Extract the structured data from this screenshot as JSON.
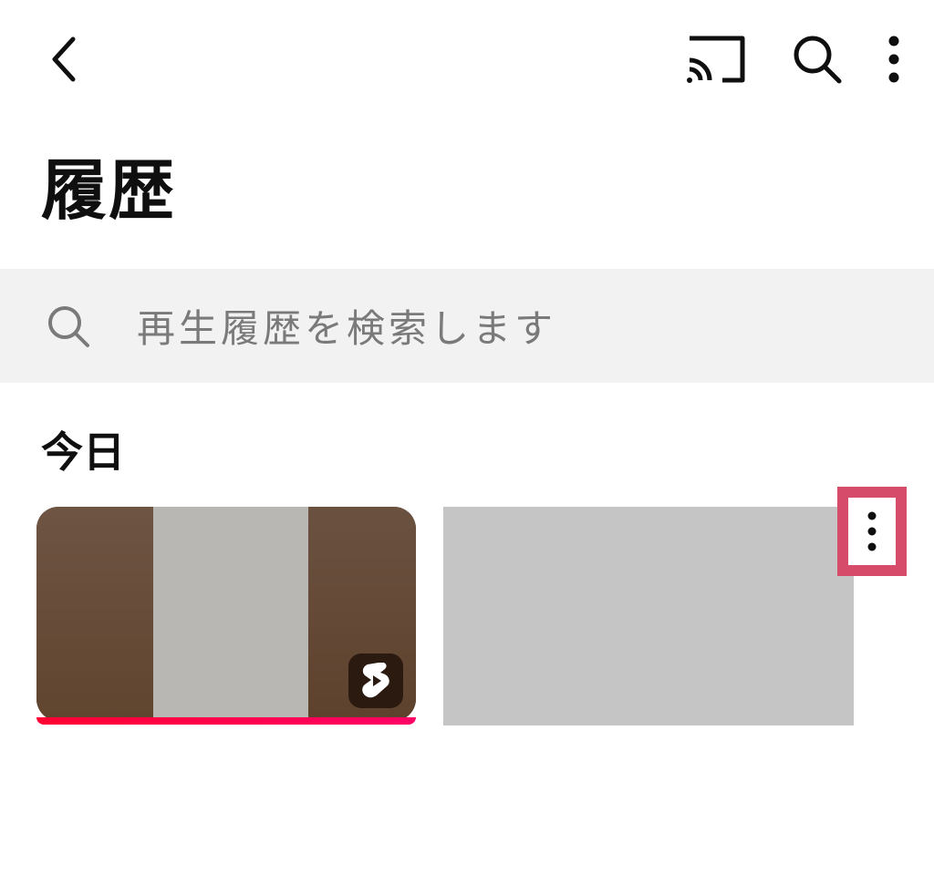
{
  "header": {
    "back": "back",
    "cast": "cast",
    "search": "search",
    "more": "more"
  },
  "page": {
    "title": "履歴"
  },
  "searchBar": {
    "placeholder": "再生履歴を検索します"
  },
  "sections": [
    {
      "label": "今日"
    }
  ],
  "items": [
    {
      "type": "shorts",
      "badge": "shorts"
    },
    {
      "type": "video"
    }
  ],
  "highlight": {
    "target": "item-options"
  }
}
